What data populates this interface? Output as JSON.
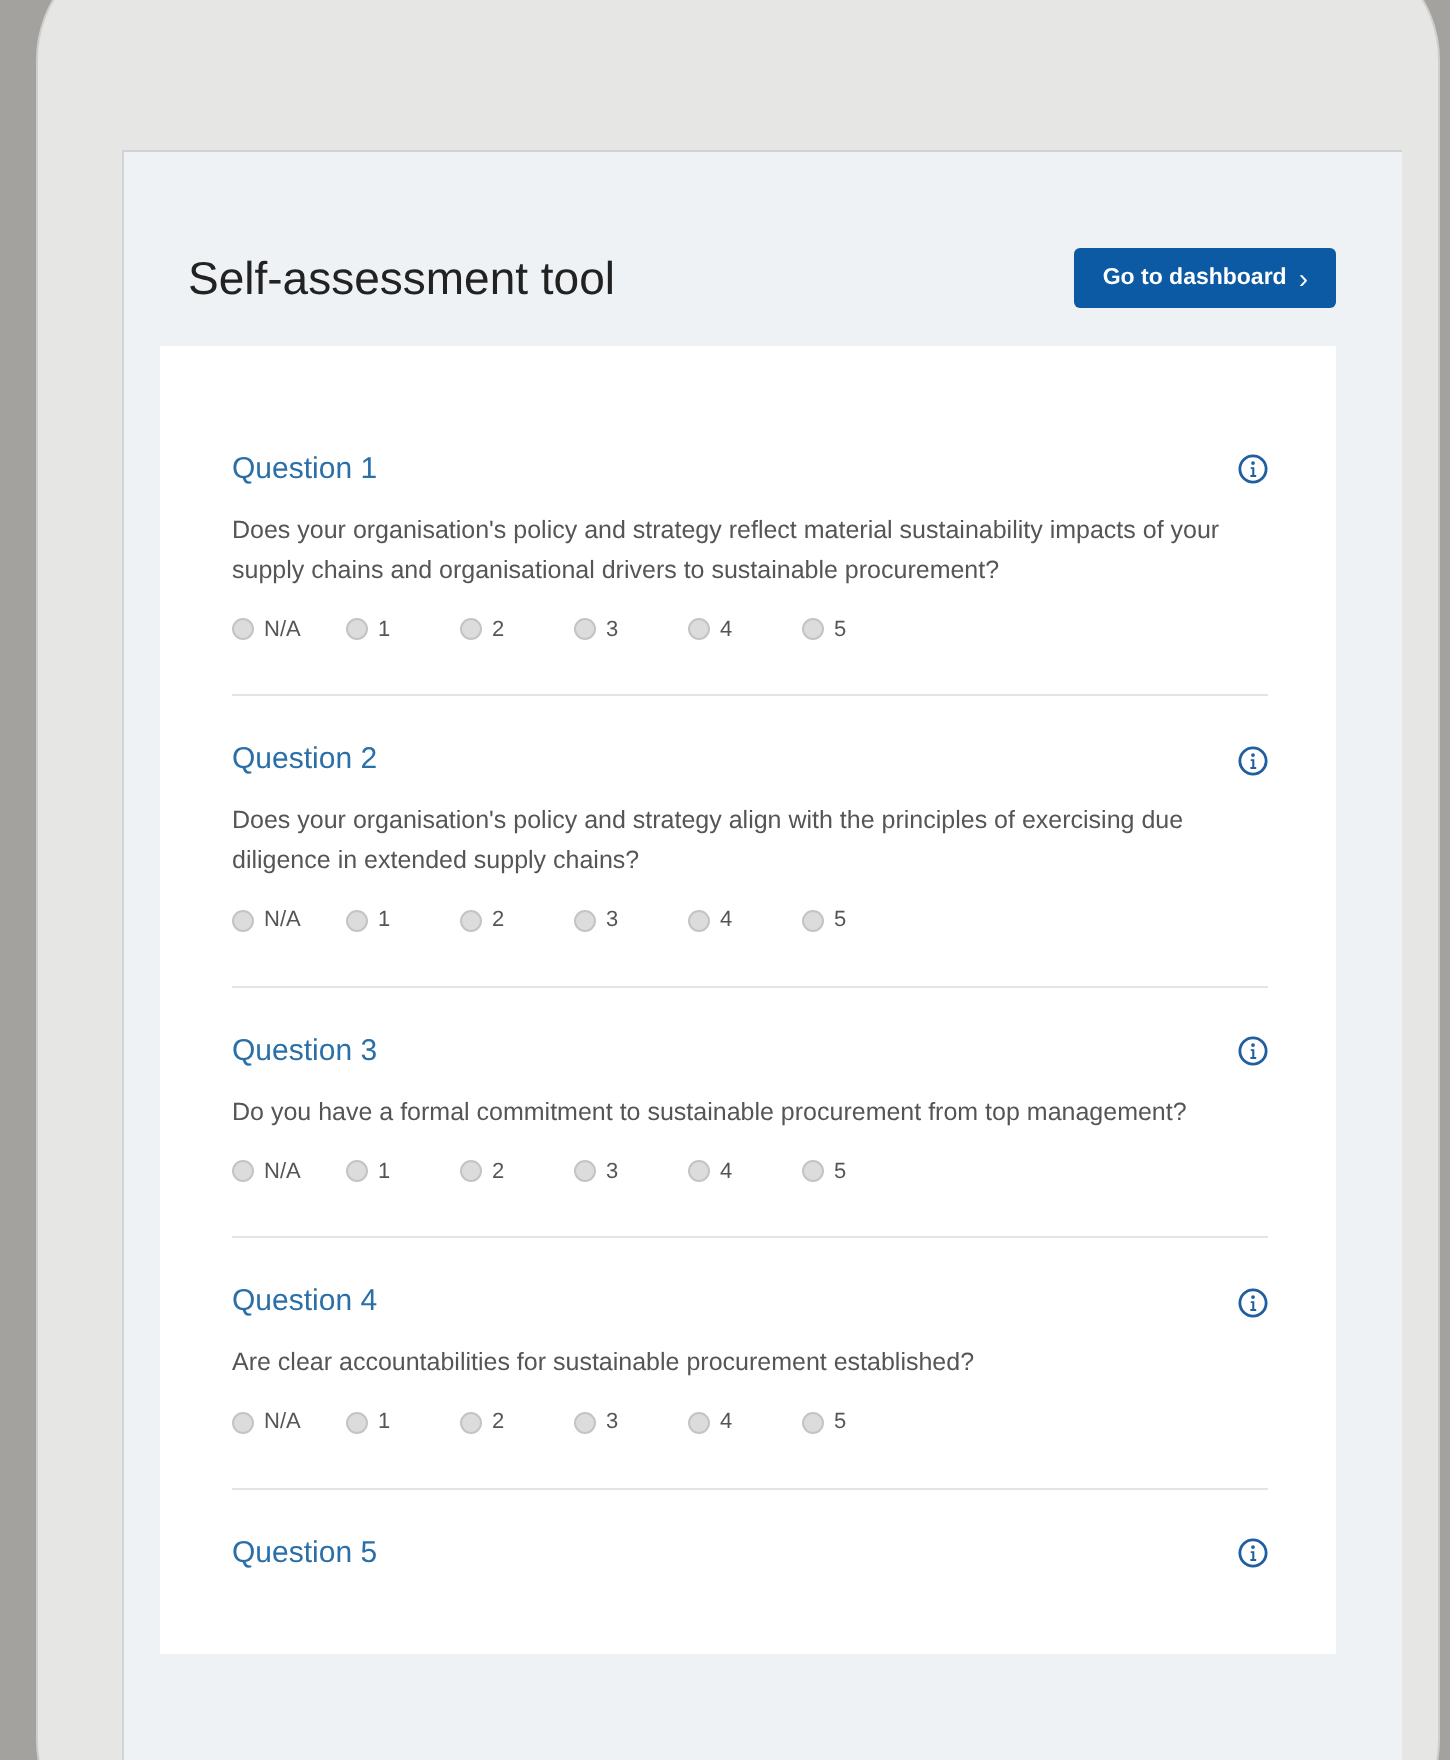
{
  "page": {
    "title": "Self-assessment tool",
    "dashboard_button": "Go to dashboard",
    "dashboard_button_icon": "›"
  },
  "questions": [
    {
      "title": "Question 1",
      "text": "Does your organisation's policy and strategy reflect material sustainability impacts of your supply chains and organisational drivers to sustainable procurement?",
      "options": [
        {
          "label": "N/A",
          "selected": false
        },
        {
          "label": "1",
          "selected": false
        },
        {
          "label": "2",
          "selected": false
        },
        {
          "label": "3",
          "selected": false
        },
        {
          "label": "4",
          "selected": false
        },
        {
          "label": "5",
          "selected": false
        }
      ]
    },
    {
      "title": "Question 2",
      "text": "Does your organisation's policy and strategy align with the principles of exercising due diligence in extended supply chains?",
      "options": [
        {
          "label": "N/A",
          "selected": false
        },
        {
          "label": "1",
          "selected": false
        },
        {
          "label": "2",
          "selected": false
        },
        {
          "label": "3",
          "selected": false
        },
        {
          "label": "4",
          "selected": false
        },
        {
          "label": "5",
          "selected": false
        }
      ]
    },
    {
      "title": "Question 3",
      "text": "Do you have a formal commitment to sustainable procurement from top management?",
      "options": [
        {
          "label": "N/A",
          "selected": false
        },
        {
          "label": "1",
          "selected": false
        },
        {
          "label": "2",
          "selected": false
        },
        {
          "label": "3",
          "selected": false
        },
        {
          "label": "4",
          "selected": false
        },
        {
          "label": "5",
          "selected": false
        }
      ]
    },
    {
      "title": "Question 4",
      "text": "Are clear accountabilities for sustainable procurement established?",
      "options": [
        {
          "label": "N/A",
          "selected": false
        },
        {
          "label": "1",
          "selected": false
        },
        {
          "label": "2",
          "selected": false
        },
        {
          "label": "3",
          "selected": false
        },
        {
          "label": "4",
          "selected": false
        },
        {
          "label": "5",
          "selected": false
        }
      ]
    },
    {
      "title": "Question 5"
    }
  ]
}
